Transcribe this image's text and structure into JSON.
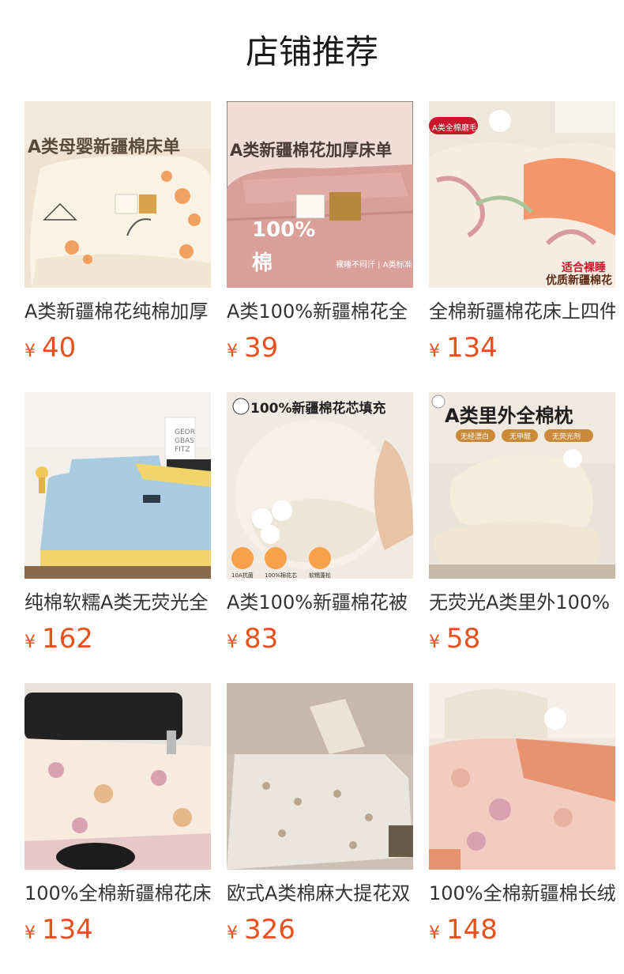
{
  "page": {
    "title": "店铺推荐",
    "currency_symbol": "¥",
    "price_color": "#e8501c"
  },
  "products": [
    {
      "name": "A类新疆棉花纯棉加厚",
      "price": "40",
      "image_text": [
        "A类母婴新疆棉床单"
      ],
      "image_palette": {
        "bg": "#efe3cf",
        "fabric": "#faf3e3",
        "accent": "#f0a060"
      }
    },
    {
      "name": "A类100%新疆棉花全",
      "price": "39",
      "image_text": [
        "A类新疆棉花加厚床单",
        "100%",
        "棉",
        "裸睡不闷汗 | A类标准"
      ],
      "image_palette": {
        "bg": "#f1dcd6",
        "fabric": "#d9a09a",
        "accent": "#c98a83"
      }
    },
    {
      "name": "全棉新疆棉花床上四件",
      "price": "134",
      "image_text": [
        "A类全棉磨毛",
        "适合裸睡",
        "优质新疆棉花"
      ],
      "image_palette": {
        "bg": "#efe6dc",
        "fabric": "#f7ece2",
        "accent": "#f4956a"
      }
    },
    {
      "name": "纯棉软糯A类无荧光全",
      "price": "162",
      "image_text": [
        "GEOR",
        "GBAS",
        "FITZ"
      ],
      "image_palette": {
        "bg": "#f2efea",
        "fabric": "#a9cbe0",
        "accent": "#f1d56a"
      }
    },
    {
      "name": "A类100%新疆棉花被",
      "price": "83",
      "image_text": [
        "100%新疆棉花芯填充",
        "10A抗菌",
        "100%棉花芯",
        "软糯蓬松"
      ],
      "image_palette": {
        "bg": "#efeae2",
        "fabric": "#f6f1e8",
        "accent": "#e08a3c"
      }
    },
    {
      "name": "无荧光A类里外100%",
      "price": "58",
      "image_text": [
        "A类里外全棉枕",
        "无经漂白",
        "无甲醛",
        "无荧光剂"
      ],
      "image_palette": {
        "bg": "#e9e3d9",
        "fabric": "#f5ecdc",
        "accent": "#c98a3a"
      }
    },
    {
      "name": "100%全棉新疆棉花床",
      "price": "134",
      "image_text": [],
      "image_palette": {
        "bg": "#e7e2db",
        "fabric": "#f7eadf",
        "accent": "#d8a0b0"
      }
    },
    {
      "name": "欧式A类棉麻大提花双",
      "price": "326",
      "image_text": [],
      "image_palette": {
        "bg": "#cdbfb4",
        "fabric": "#eae6dd",
        "accent": "#b9a58d"
      }
    },
    {
      "name": "100%全棉新疆棉长绒",
      "price": "148",
      "image_text": [],
      "image_palette": {
        "bg": "#f0e7dd",
        "fabric": "#f3ccc0",
        "accent": "#e8936f"
      }
    }
  ]
}
